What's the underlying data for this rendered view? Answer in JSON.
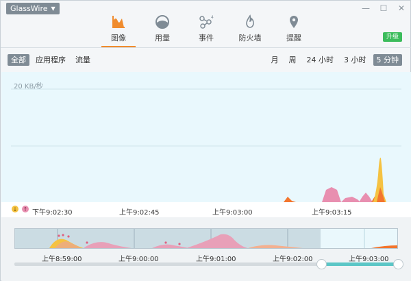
{
  "app": {
    "name": "GlassWire"
  },
  "window_controls": {
    "minimize": "—",
    "maximize": "☐",
    "close": "✕"
  },
  "nav": {
    "tabs": [
      {
        "label": "图像",
        "icon": "graph-icon",
        "active": true
      },
      {
        "label": "用量",
        "icon": "usage-pie-icon",
        "active": false
      },
      {
        "label": "事件",
        "icon": "events-nodes-icon",
        "active": false
      },
      {
        "label": "防火墙",
        "icon": "firewall-flame-icon",
        "active": false
      },
      {
        "label": "提醒",
        "icon": "alert-pin-icon",
        "active": false
      }
    ],
    "upgrade_label": "升级"
  },
  "filters": {
    "items": [
      "全部",
      "应用程序",
      "流量"
    ],
    "selected": "全部"
  },
  "time_ranges": {
    "items": [
      "月",
      "周",
      "24 小时",
      "3 小时",
      "5 分钟"
    ],
    "selected": "5 分钟"
  },
  "graph": {
    "y_label": "20 KB/秒",
    "time_labels": [
      "下午9:02:30",
      "上午9:02:45",
      "上午9:03:00",
      "上午9:03:15"
    ]
  },
  "overview": {
    "time_labels": [
      "上午8:59:00",
      "上午9:00:00",
      "上午9:01:00",
      "上午9:02:00",
      "上午9:03:00"
    ]
  },
  "colors": {
    "accent": "#f08c2e",
    "incoming": "#f5c242",
    "outgoing": "#e88fb0",
    "both": "#f3762e",
    "chart_bg": "#e9f8fd",
    "upgrade": "#3cbc5c"
  }
}
